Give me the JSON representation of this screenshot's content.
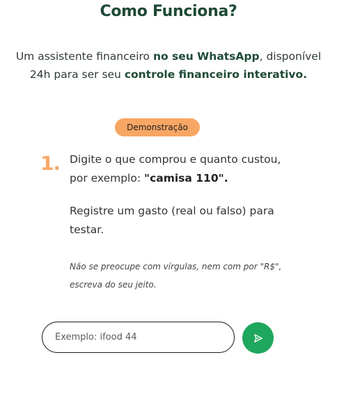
{
  "header": {
    "title": "Como Funciona?"
  },
  "intro": {
    "part1": "Um assistente financeiro ",
    "bold1": "no seu WhatsApp",
    "part2": ", disponível 24h para ser seu ",
    "bold2": "controle financeiro interativo."
  },
  "badge": {
    "label": "Demonstração"
  },
  "step": {
    "number": "1.",
    "text_part1": "Digite o que comprou e quanto custou, por exemplo: ",
    "text_bold": "\"camisa 110\".",
    "text2": "Registre um gasto (real ou falso) para testar.",
    "note": "Não se preocupe com vírgulas, nem com por \"R$\", escreva do seu jeito."
  },
  "input": {
    "value": "",
    "placeholder": "Exemplo: ifood 44"
  },
  "send_button": {
    "icon": "send-icon",
    "color": "#1fa75e"
  },
  "colors": {
    "title": "#1f4a36",
    "accent": "#f8a664",
    "primary_button": "#1fa75e"
  }
}
